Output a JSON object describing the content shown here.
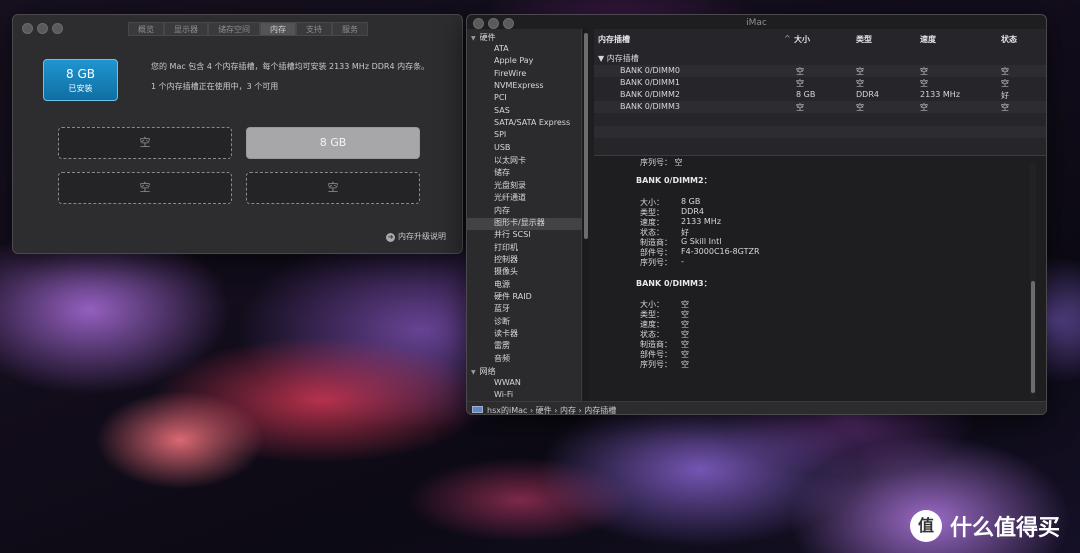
{
  "about": {
    "tabs": [
      "概览",
      "显示器",
      "储存空间",
      "内存",
      "支持",
      "服务"
    ],
    "selected_tab": "内存",
    "badge": {
      "size": "8 GB",
      "status": "已安装"
    },
    "info_line1": "您的 Mac 包含 4 个内存插槽，每个插槽均可安装 2133 MHz DDR4 内存条。",
    "info_line2": "1 个内存插槽正在使用中，3 个可用",
    "slots": [
      "空",
      "8 GB",
      "空",
      "空"
    ],
    "upgrade_link": "内存升级说明"
  },
  "sysinfo": {
    "title": "iMac",
    "sidebar": {
      "group_hardware": "硬件",
      "items": [
        "ATA",
        "Apple Pay",
        "FireWire",
        "NVMExpress",
        "PCI",
        "SAS",
        "SATA/SATA Express",
        "SPI",
        "USB",
        "以太网卡",
        "储存",
        "光盘刻录",
        "光纤通道",
        "内存",
        "图形卡/显示器",
        "并行 SCSI",
        "打印机",
        "控制器",
        "摄像头",
        "电源",
        "硬件 RAID",
        "蓝牙",
        "诊断",
        "读卡器",
        "雷雳",
        "音频"
      ],
      "selected": "内存",
      "group_network": "网络",
      "network_items": [
        "WWAN",
        "Wi-Fi"
      ]
    },
    "table": {
      "headers": [
        "内存插槽",
        "大小",
        "类型",
        "速度",
        "状态"
      ],
      "group_label": "内存插槽",
      "rows": [
        [
          "BANK 0/DIMM0",
          "空",
          "空",
          "空",
          "空"
        ],
        [
          "BANK 0/DIMM1",
          "空",
          "空",
          "空",
          "空"
        ],
        [
          "BANK 0/DIMM2",
          "8 GB",
          "DDR4",
          "2133 MHz",
          "好"
        ],
        [
          "BANK 0/DIMM3",
          "空",
          "空",
          "空",
          "空"
        ]
      ]
    },
    "detail": {
      "top_line": "序列号：  空",
      "dimm2_title": "BANK 0/DIMM2：",
      "dimm2": [
        [
          "大小：",
          "8 GB"
        ],
        [
          "类型：",
          "DDR4"
        ],
        [
          "速度：",
          "2133 MHz"
        ],
        [
          "状态：",
          "好"
        ],
        [
          "制造商：",
          "G Skill Intl"
        ],
        [
          "部件号：",
          "F4-3000C16-8GTZR"
        ],
        [
          "序列号：",
          "-"
        ]
      ],
      "dimm3_title": "BANK 0/DIMM3：",
      "dimm3": [
        [
          "大小：",
          "空"
        ],
        [
          "类型：",
          "空"
        ],
        [
          "速度：",
          "空"
        ],
        [
          "状态：",
          "空"
        ],
        [
          "制造商：",
          "空"
        ],
        [
          "部件号：",
          "空"
        ],
        [
          "序列号：",
          "空"
        ]
      ]
    },
    "path": "hsx的iMac › 硬件 › 内存 › 内存插槽"
  },
  "watermark": {
    "icon_glyph": "值",
    "text": "什么值得买"
  }
}
